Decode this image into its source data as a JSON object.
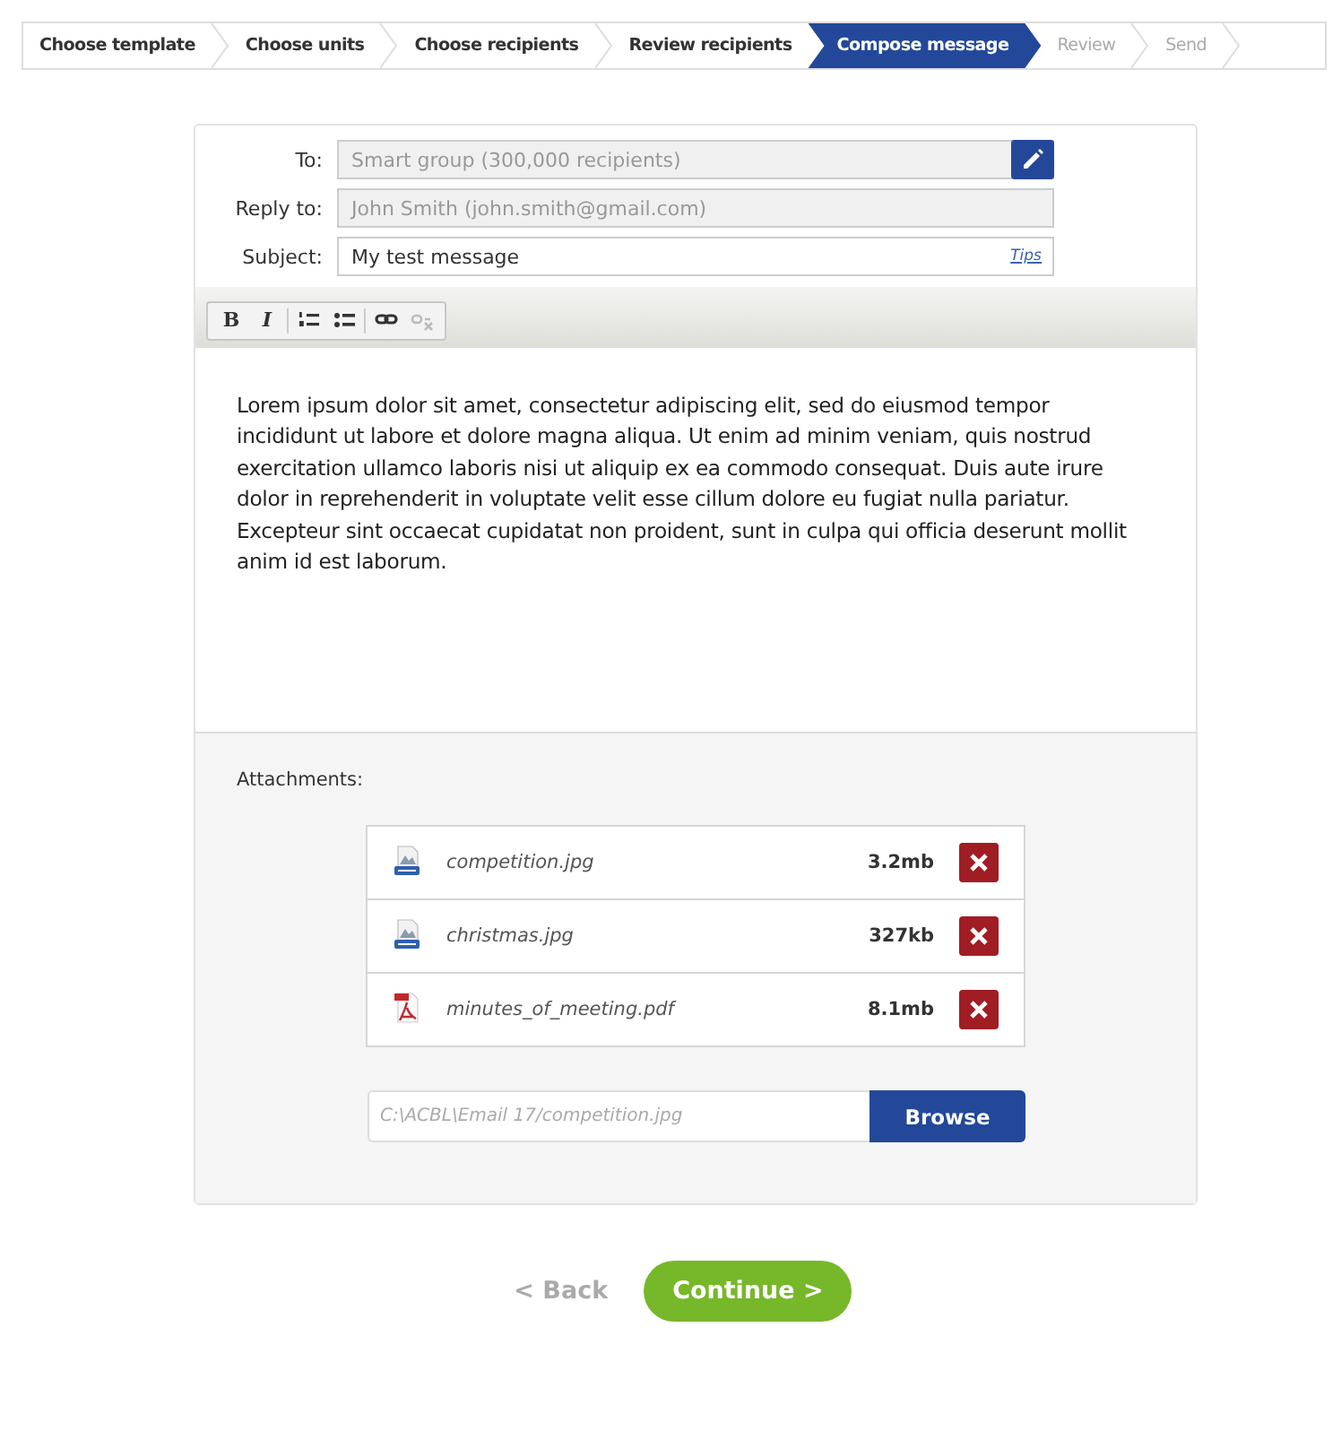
{
  "steps": [
    {
      "label": "Choose template",
      "selected": false,
      "disabled": false
    },
    {
      "label": "Choose units",
      "selected": false,
      "disabled": false
    },
    {
      "label": "Choose recipients",
      "selected": false,
      "disabled": false
    },
    {
      "label": "Review recipients",
      "selected": false,
      "disabled": false
    },
    {
      "label": "Compose message",
      "selected": true,
      "disabled": false
    },
    {
      "label": "Review",
      "selected": false,
      "disabled": true
    },
    {
      "label": "Send",
      "selected": false,
      "disabled": true
    }
  ],
  "fields": [
    {
      "label": "To:",
      "value": "Smart group (300,000 recipients)",
      "disabled": true,
      "kind": "edit"
    },
    {
      "label": "Reply to:",
      "value": "John Smith (john.smith@gmail.com)",
      "disabled": true,
      "kind": "plain"
    },
    {
      "label": "Subject:",
      "value": "My test message",
      "disabled": false,
      "kind": "tips",
      "link": "Tips"
    }
  ],
  "toolbar": [
    {
      "kind": "bold",
      "label": "B",
      "disabled": false
    },
    {
      "kind": "italic",
      "label": "I",
      "disabled": false
    },
    {
      "kind": "ordered-list",
      "disabled": false
    },
    {
      "kind": "bullet-list",
      "disabled": false
    },
    {
      "kind": "link",
      "disabled": false
    },
    {
      "kind": "unlink",
      "disabled": true
    }
  ],
  "body": "Lorem ipsum dolor sit amet, consectetur adipiscing elit, sed do eiusmod tempor incididunt ut labore et dolore magna aliqua. Ut enim ad minim veniam, quis nostrud exercitation ullamco laboris nisi ut aliquip ex ea commodo consequat. Duis aute irure dolor in reprehenderit in voluptate velit esse cillum dolore eu fugiat nulla pariatur. Excepteur sint occaecat cupidatat non proident, sunt in culpa qui officia deserunt mollit anim id est laborum.",
  "attachments": {
    "label": "Attachments:",
    "files": [
      {
        "kind": "jpeg",
        "name": "competition.jpg",
        "size": "3.2mb"
      },
      {
        "kind": "jpeg",
        "name": "christmas.jpg",
        "size": "327kb"
      },
      {
        "kind": "pdf",
        "name": "minutes_of_meeting.pdf",
        "size": "8.1mb"
      }
    ],
    "path": {
      "placeholder": "C:\\ACBL\\Email 17/competition.jpg"
    },
    "browse": "Browse"
  },
  "back": "< Back",
  "continue": "Continue >"
}
